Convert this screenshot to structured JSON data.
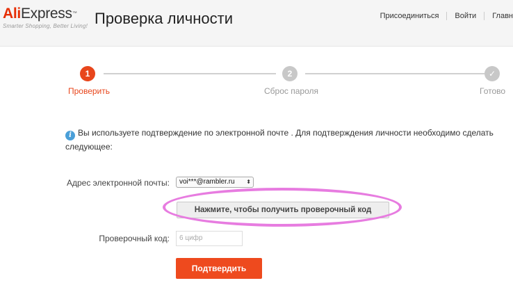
{
  "header": {
    "logo": {
      "brand_ali": "Ali",
      "brand_express": "Express",
      "trademark": "™",
      "tagline": "Smarter Shopping, Better Living!"
    },
    "page_title": "Проверка личности",
    "nav": [
      "Присоединиться",
      "Войти",
      "Главн"
    ]
  },
  "stepper": {
    "steps": [
      {
        "number": "1",
        "label": "Проверить",
        "state": "active"
      },
      {
        "number": "2",
        "label": "Сброс пароля",
        "state": "pending"
      },
      {
        "number": "✓",
        "label": "Готово",
        "state": "pending"
      }
    ],
    "colors": {
      "active": "#e8461c",
      "inactive": "#c8c8c8",
      "active_text": "#e8461c",
      "inactive_text": "#999999"
    }
  },
  "info": {
    "icon": "info-icon",
    "text": "Вы используете подтверждение по электронной почте . Для подтверждения личности необходимо сделать следующее:"
  },
  "form": {
    "email_label": "Адрес электронной почты:",
    "email_value": "voi***@rambler.ru",
    "get_code_button": "Нажмите, чтобы получить проверочный код",
    "code_label": "Проверочный код:",
    "code_placeholder": "6 цифр",
    "confirm_button": "Подтвердить"
  },
  "colors": {
    "brand": "#e62e04",
    "confirm": "#ee4a1e",
    "highlight": "#e77ce0"
  }
}
